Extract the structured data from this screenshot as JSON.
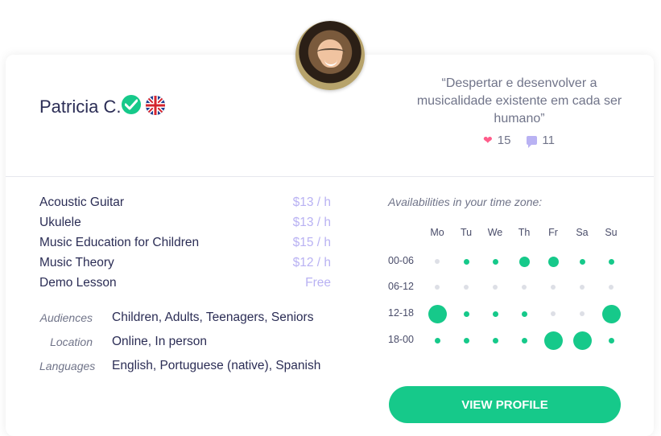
{
  "tutor": {
    "name": "Patricia C.",
    "verified_icon": "check-circle-icon",
    "flag_icon": "uk-flag-icon",
    "quote": "“Despertar e desenvolver a musicalidade existente em cada ser humano”",
    "likes": "15",
    "comments": "11"
  },
  "subjects": [
    {
      "name": "Acoustic Guitar",
      "price": "$13 / h"
    },
    {
      "name": "Ukulele",
      "price": "$13 / h"
    },
    {
      "name": "Music Education for Children",
      "price": "$15 / h"
    },
    {
      "name": "Music Theory",
      "price": "$12 / h"
    },
    {
      "name": "Demo Lesson",
      "price": "Free"
    }
  ],
  "meta": {
    "audiences_label": "Audiences",
    "audiences": "Children, Adults, Teenagers, Seniors",
    "location_label": "Location",
    "location": "Online, In person",
    "languages_label": "Languages",
    "languages": "English, Portuguese (native), Spanish"
  },
  "availability": {
    "title": "Availabilities in your time zone:",
    "days": [
      "Mo",
      "Tu",
      "We",
      "Th",
      "Fr",
      "Sa",
      "Su"
    ],
    "slots": [
      "00-06",
      "06-12",
      "12-18",
      "18-00"
    ],
    "levels": [
      [
        0,
        1,
        1,
        2,
        2,
        1,
        1
      ],
      [
        0,
        0,
        0,
        0,
        0,
        0,
        0
      ],
      [
        3,
        1,
        1,
        1,
        0,
        0,
        3
      ],
      [
        1,
        1,
        1,
        1,
        3,
        3,
        1
      ]
    ]
  },
  "colors": {
    "accent": "#16c98a",
    "price": "#b9b2f3",
    "inactive_dot": "#dddfe6"
  },
  "button": {
    "label": "VIEW PROFILE"
  }
}
